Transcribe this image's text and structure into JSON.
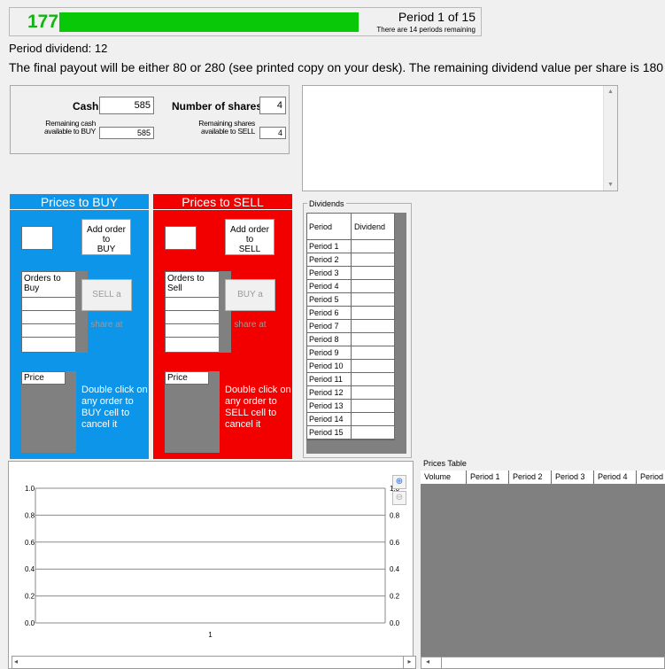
{
  "top": {
    "timer": "177",
    "period_title": "Period 1 of 15",
    "period_remaining": "There are 14 periods remaining"
  },
  "info": {
    "dividend_line": "Period dividend: 12",
    "payout_line": "The final payout will be either 80 or 280 (see printed copy on your desk). The remaining dividend value per share is 180"
  },
  "account": {
    "cash_label": "Cash",
    "cash_value": "585",
    "shares_label": "Number of shares",
    "shares_value": "4",
    "remaining_cash_label_1": "Remaining cash",
    "remaining_cash_label_2": "available to BUY",
    "remaining_cash_value": "585",
    "remaining_shares_label_1": "Remaining shares",
    "remaining_shares_label_2": "available to SELL",
    "remaining_shares_value": "4"
  },
  "buy": {
    "title": "Prices to BUY",
    "add_btn_1": "Add order to",
    "add_btn_2": "BUY",
    "orders_head_1": "Orders to",
    "orders_head_2": "Buy",
    "trade_btn": "SELL a share at",
    "price_head": "Price",
    "cancel_note": "Double click on any order to BUY cell to cancel it"
  },
  "sell": {
    "title": "Prices to SELL",
    "add_btn_1": "Add order to",
    "add_btn_2": "SELL",
    "orders_head_1": "Orders to",
    "orders_head_2": "Sell",
    "trade_btn": "BUY a share at",
    "price_head": "Price",
    "cancel_note": "Double click on any order to SELL cell to cancel it"
  },
  "dividends": {
    "legend": "Dividends",
    "col_period": "Period",
    "col_dividend": "Dividend",
    "rows": [
      "Period 1",
      "Period 2",
      "Period 3",
      "Period 4",
      "Period 5",
      "Period 6",
      "Period 7",
      "Period 8",
      "Period 9",
      "Period 10",
      "Period 11",
      "Period 12",
      "Period 13",
      "Period 14",
      "Period 15"
    ]
  },
  "chart_data": {
    "type": "line",
    "categories": [
      "1"
    ],
    "series": [],
    "ylim": [
      0.0,
      1.0
    ],
    "yticks": [
      "0.0",
      "0.2",
      "0.4",
      "0.6",
      "0.8",
      "1.0"
    ],
    "grid": true,
    "title": "",
    "xlabel": "",
    "ylabel": ""
  },
  "prices_table": {
    "legend": "Prices Table",
    "columns": [
      "Volume",
      "Period 1",
      "Period 2",
      "Period 3",
      "Period 4",
      "Period"
    ]
  },
  "icons": {
    "zoom_in": "zoom-in-icon",
    "zoom_out": "zoom-out-icon",
    "scroll_left": "scroll-left-arrow-icon",
    "scroll_right": "scroll-right-arrow-icon"
  },
  "colors": {
    "buy_panel": "#0d96e9",
    "sell_panel": "#f20000",
    "progress": "#08c808",
    "timer": "#12b312"
  }
}
